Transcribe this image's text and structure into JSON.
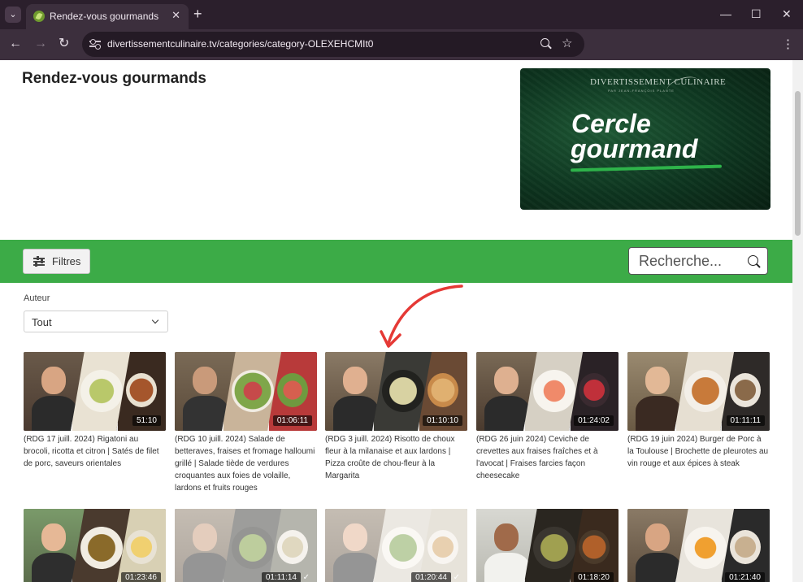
{
  "browser": {
    "tab_title": "Rendez-vous gourmands",
    "url": "divertissementculinaire.tv/categories/category-OLEXEHCMIt0",
    "icons": [
      "tab-menu-icon",
      "favicon-icon",
      "close-icon",
      "plus-icon",
      "minimize-icon",
      "maximize-icon",
      "close-window-icon",
      "back-icon",
      "forward-icon",
      "reload-icon",
      "site-settings-icon",
      "zoom-icon",
      "star-icon",
      "menu-icon"
    ]
  },
  "page": {
    "title": "Rendez-vous gourmands",
    "banner": {
      "brand": "DIVERTISSEMENT CULINAIRE",
      "brand_sub": "PAR JEAN-FRANÇOIS PLANTE",
      "line1": "Cercle",
      "line2": "gourmand",
      "accent_color": "#2eb34a"
    },
    "toolbar": {
      "filters_label": "Filtres",
      "search_placeholder": "Recherche...",
      "bar_color": "#3cab47"
    },
    "filters": {
      "author_label": "Auteur",
      "author_value": "Tout"
    },
    "videos": [
      {
        "title": "(RDG 17 juill. 2024) Rigatoni au brocoli, ricotta et citron | Satés de filet de porc, saveurs orientales",
        "duration": "51:10"
      },
      {
        "title": "(RDG 10 juill. 2024) Salade de betteraves, fraises et fromage halloumi grillé | Salade tiède de verdures croquantes aux foies de volaille, lardons et fruits rouges",
        "duration": "01:06:11"
      },
      {
        "title": "(RDG 3 juill. 2024) Risotto de choux fleur à la milanaise et aux lardons | Pizza croûte de chou-fleur à la Margarita",
        "duration": "01:10:10"
      },
      {
        "title": "(RDG 26 juin 2024) Ceviche de crevettes aux fraises fraîches et à l'avocat | Fraises farcies façon cheesecake",
        "duration": "01:24:02"
      },
      {
        "title": "(RDG 19 juin 2024) Burger de Porc à la Toulouse | Brochette de pleurotes au vin rouge et aux épices à steak",
        "duration": "01:11:11"
      },
      {
        "title": "",
        "duration": "01:23:46"
      },
      {
        "title": "",
        "duration": "01:11:14",
        "watched": true
      },
      {
        "title": "",
        "duration": "01:20:44",
        "watched": true
      },
      {
        "title": "",
        "duration": "01:18:20"
      },
      {
        "title": "",
        "duration": "01:21:40"
      }
    ]
  }
}
